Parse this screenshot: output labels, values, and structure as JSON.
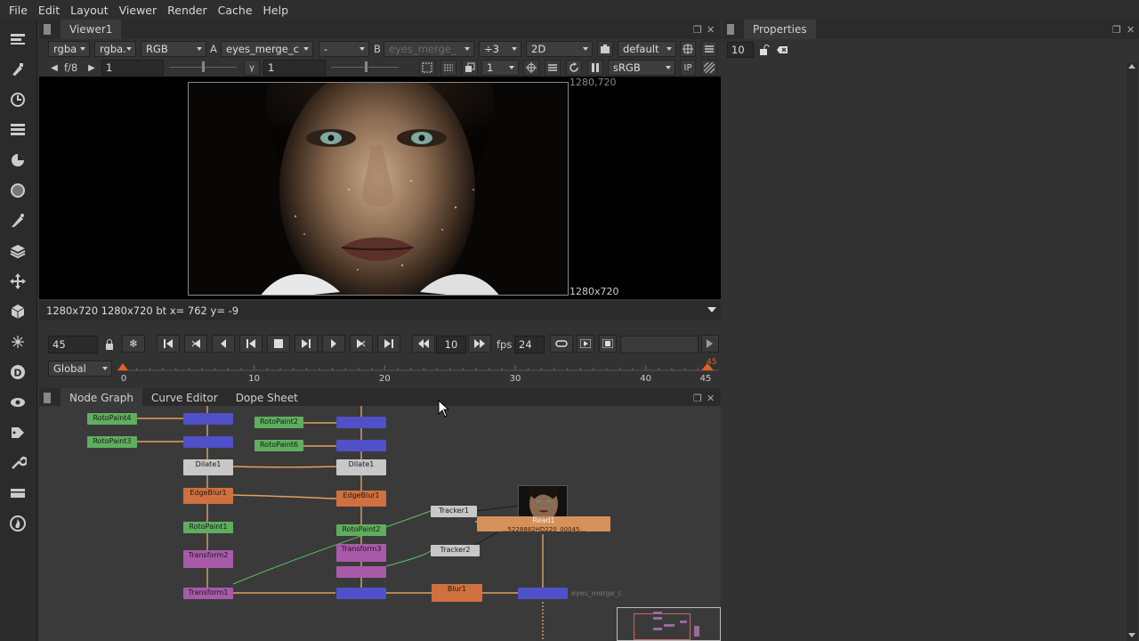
{
  "menu": [
    "File",
    "Edit",
    "Layout",
    "Viewer",
    "Render",
    "Cache",
    "Help"
  ],
  "viewer": {
    "tab": "Viewer1",
    "channels": "rgba",
    "channels2": "rgba.",
    "display": "RGB",
    "a_label": "A",
    "a_input": "eyes_merge_c",
    "wipe": "-",
    "b_label": "B",
    "b_input": "eyes_merge_",
    "gain_sel": "÷3",
    "mode": "2D",
    "lut_default": "default",
    "fstop": "f/8",
    "gain_value": "1",
    "gamma_label": "γ",
    "gamma_value": "1",
    "proxy_value": "1",
    "colorspace": "sRGB",
    "ip_label": "IP",
    "format_top": "1280,720",
    "format_bottom": "1280x720",
    "info": "1280x720 1280x720 bt  x= 762 y=  -9"
  },
  "playback": {
    "frame": "45",
    "step": "10",
    "fps_label": "fps",
    "fps": "24",
    "range_mode": "Global",
    "ticks": [
      "0",
      "10",
      "20",
      "30",
      "40",
      "45"
    ],
    "end_marker": "45"
  },
  "graph_tabs": [
    "Node Graph",
    "Curve Editor",
    "Dope Sheet"
  ],
  "properties": {
    "tab": "Properties",
    "max_panels": "10"
  },
  "nodes": {
    "rotopaint4": "RotoPaint4",
    "rotopaint3": "RotoPaint3",
    "rotopaint2": "RotoPaint2",
    "rotopaint6": "RotoPaint6",
    "dilate1": "Dilate1",
    "dilate1b": "Dilate1",
    "dilate_sub": "(all)",
    "edgeblur1": "EdgeBlur1",
    "edgeblur1b": "EdgeBlur1",
    "rotopaint1": "RotoPaint1",
    "rotopaint5": "RotoPaint2",
    "transform2": "Transform2",
    "transform3": "Transform3",
    "transform1": "Transform1",
    "tracker1": "Tracker1",
    "tracker2": "Tracker2",
    "read1": "Read1",
    "read_sub": "...5228882HD220_00045...",
    "blur1": "Blur1",
    "merge_out": "eyes_merge_c",
    "sub_all": "(all)"
  },
  "colors": {
    "node_green": "#5fae5f",
    "node_blue": "#5050c8",
    "node_orange": "#d0703e",
    "node_purple": "#a85aa8",
    "read_node": "#d4915a",
    "playhead": "#e06020"
  },
  "icons": [
    "viewer-icon",
    "paint-icon",
    "time-icon",
    "channel-icon",
    "color-icon",
    "filter-icon",
    "keyer-icon",
    "merge-icon",
    "transform-icon",
    "3d-icon",
    "particles-icon",
    "deep-icon",
    "views-icon",
    "metadata-icon",
    "toolsets-icon",
    "other-icon",
    "furnace-icon"
  ]
}
